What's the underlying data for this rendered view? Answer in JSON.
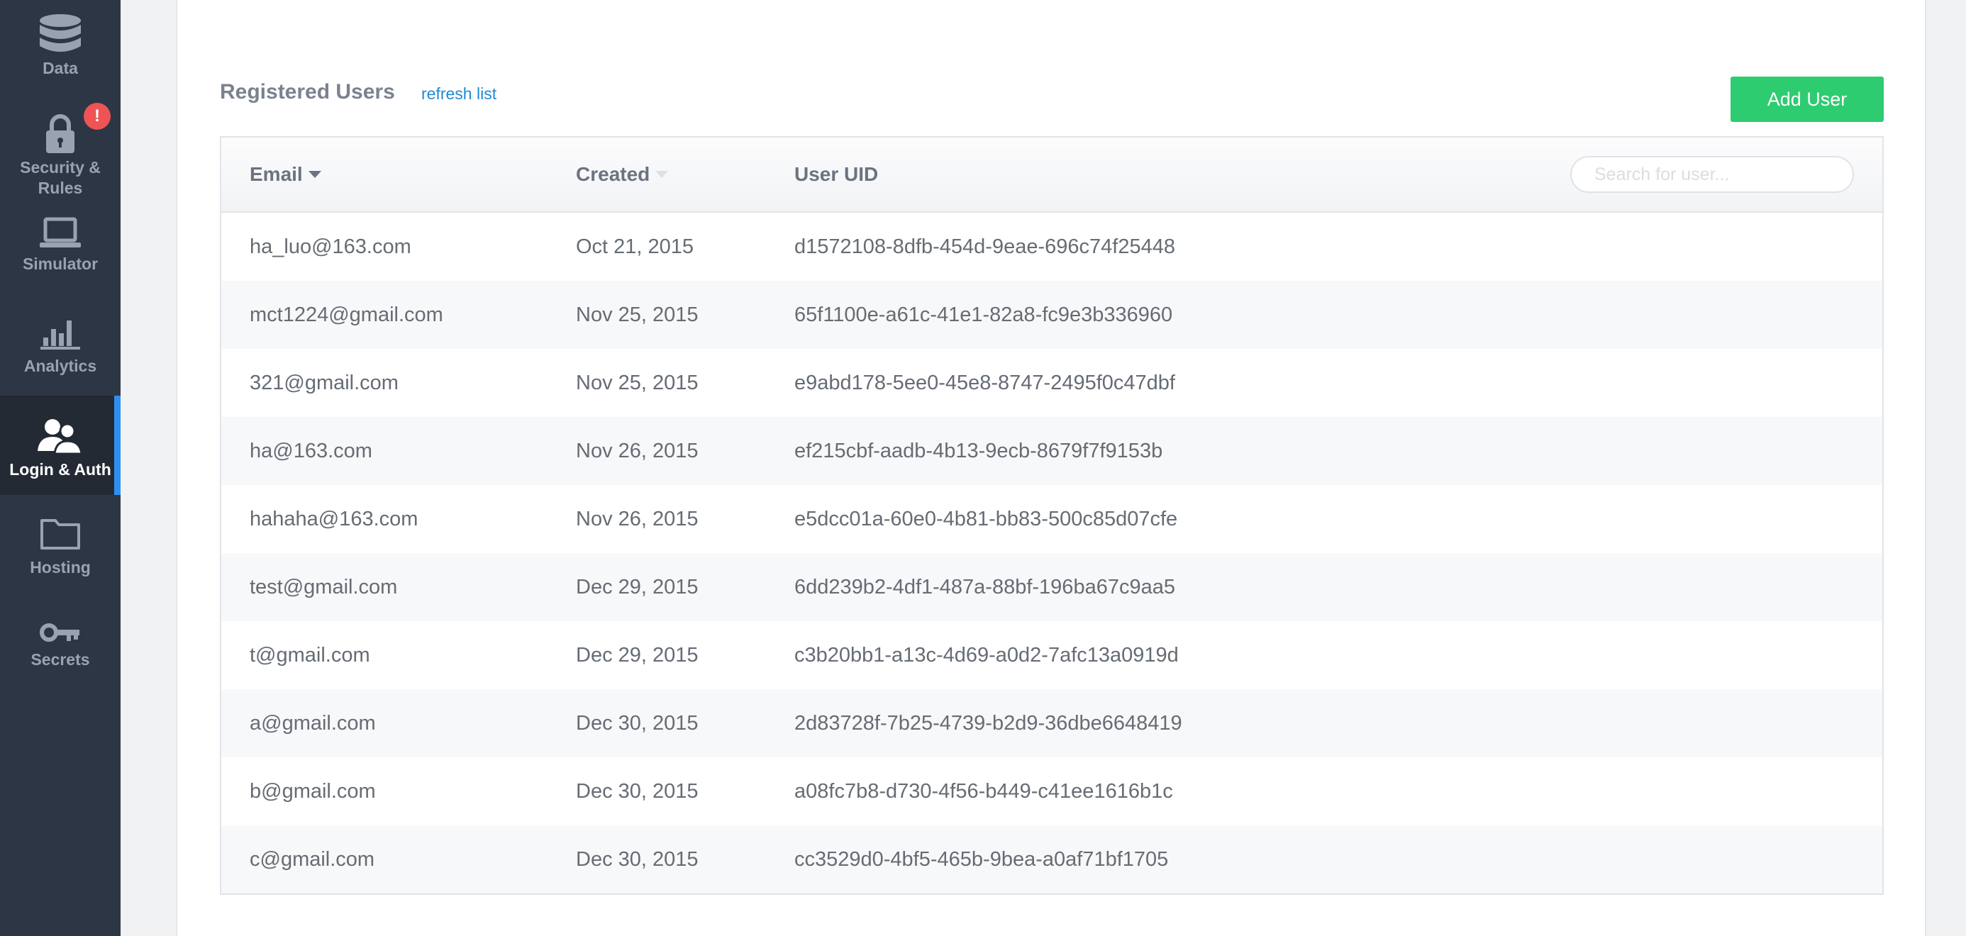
{
  "sidebar": {
    "items": [
      {
        "label": "Data",
        "icon": "database-icon"
      },
      {
        "label": "Security & Rules",
        "icon": "lock-icon",
        "badge": "!"
      },
      {
        "label": "Simulator",
        "icon": "laptop-icon"
      },
      {
        "label": "Analytics",
        "icon": "bar-chart-icon"
      },
      {
        "label": "Login & Auth",
        "icon": "users-icon",
        "active": true
      },
      {
        "label": "Hosting",
        "icon": "folder-icon"
      },
      {
        "label": "Secrets",
        "icon": "key-icon"
      }
    ]
  },
  "main": {
    "title": "Registered Users",
    "refresh_label": "refresh list",
    "add_user_label": "Add User",
    "search": {
      "placeholder": "Search for user...",
      "value": ""
    },
    "table": {
      "columns": [
        "Email",
        "Created",
        "User UID"
      ],
      "sort_column": "Email",
      "rows": [
        {
          "email": "ha_luo@163.com",
          "created": "Oct 21, 2015",
          "uid": "d1572108-8dfb-454d-9eae-696c74f25448"
        },
        {
          "email": "mct1224@gmail.com",
          "created": "Nov 25, 2015",
          "uid": "65f1100e-a61c-41e1-82a8-fc9e3b336960"
        },
        {
          "email": "321@gmail.com",
          "created": "Nov 25, 2015",
          "uid": "e9abd178-5ee0-45e8-8747-2495f0c47dbf"
        },
        {
          "email": "ha@163.com",
          "created": "Nov 26, 2015",
          "uid": "ef215cbf-aadb-4b13-9ecb-8679f7f9153b"
        },
        {
          "email": "hahaha@163.com",
          "created": "Nov 26, 2015",
          "uid": "e5dcc01a-60e0-4b81-bb83-500c85d07cfe"
        },
        {
          "email": "test@gmail.com",
          "created": "Dec 29, 2015",
          "uid": "6dd239b2-4df1-487a-88bf-196ba67c9aa5"
        },
        {
          "email": "t@gmail.com",
          "created": "Dec 29, 2015",
          "uid": "c3b20bb1-a13c-4d69-a0d2-7afc13a0919d"
        },
        {
          "email": "a@gmail.com",
          "created": "Dec 30, 2015",
          "uid": "2d83728f-7b25-4739-b2d9-36dbe6648419"
        },
        {
          "email": "b@gmail.com",
          "created": "Dec 30, 2015",
          "uid": "a08fc7b8-d730-4f56-b449-c41ee1616b1c"
        },
        {
          "email": "c@gmail.com",
          "created": "Dec 30, 2015",
          "uid": "cc3529d0-4bf5-465b-9bea-a0af71bf1705"
        }
      ]
    }
  },
  "colors": {
    "sidebar_bg": "#2d3644",
    "active_accent": "#2f8ff0",
    "add_button": "#2ecc71",
    "link": "#1e8ad4",
    "alert_badge": "#ee5454"
  }
}
